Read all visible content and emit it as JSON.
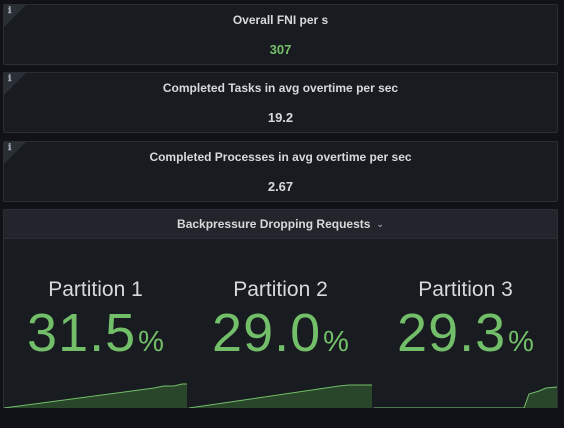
{
  "panels": [
    {
      "title": "Overall FNI per s",
      "value": "307",
      "value_color": "#73bf69"
    },
    {
      "title": "Completed Tasks in avg overtime per sec",
      "value": "19.2",
      "value_color": "#d8d9da"
    },
    {
      "title": "Completed Processes in avg overtime per sec",
      "value": "2.67",
      "value_color": "#d8d9da"
    }
  ],
  "row": {
    "title": "Backpressure Dropping Requests",
    "gauges": [
      {
        "title": "Partition 1",
        "value": "31.5",
        "unit": "%",
        "level": 31.5
      },
      {
        "title": "Partition 2",
        "value": "29.0",
        "unit": "%",
        "level": 29.0
      },
      {
        "title": "Partition 3",
        "value": "29.3",
        "unit": "%",
        "level": 29.3
      }
    ]
  },
  "colors": {
    "accent_green": "#73bf69",
    "panel_bg": "#181b1f",
    "page_bg": "#111217",
    "text": "#d8d9da"
  },
  "icons": {
    "info": "info-icon",
    "chevron": "chevron-down-icon"
  }
}
